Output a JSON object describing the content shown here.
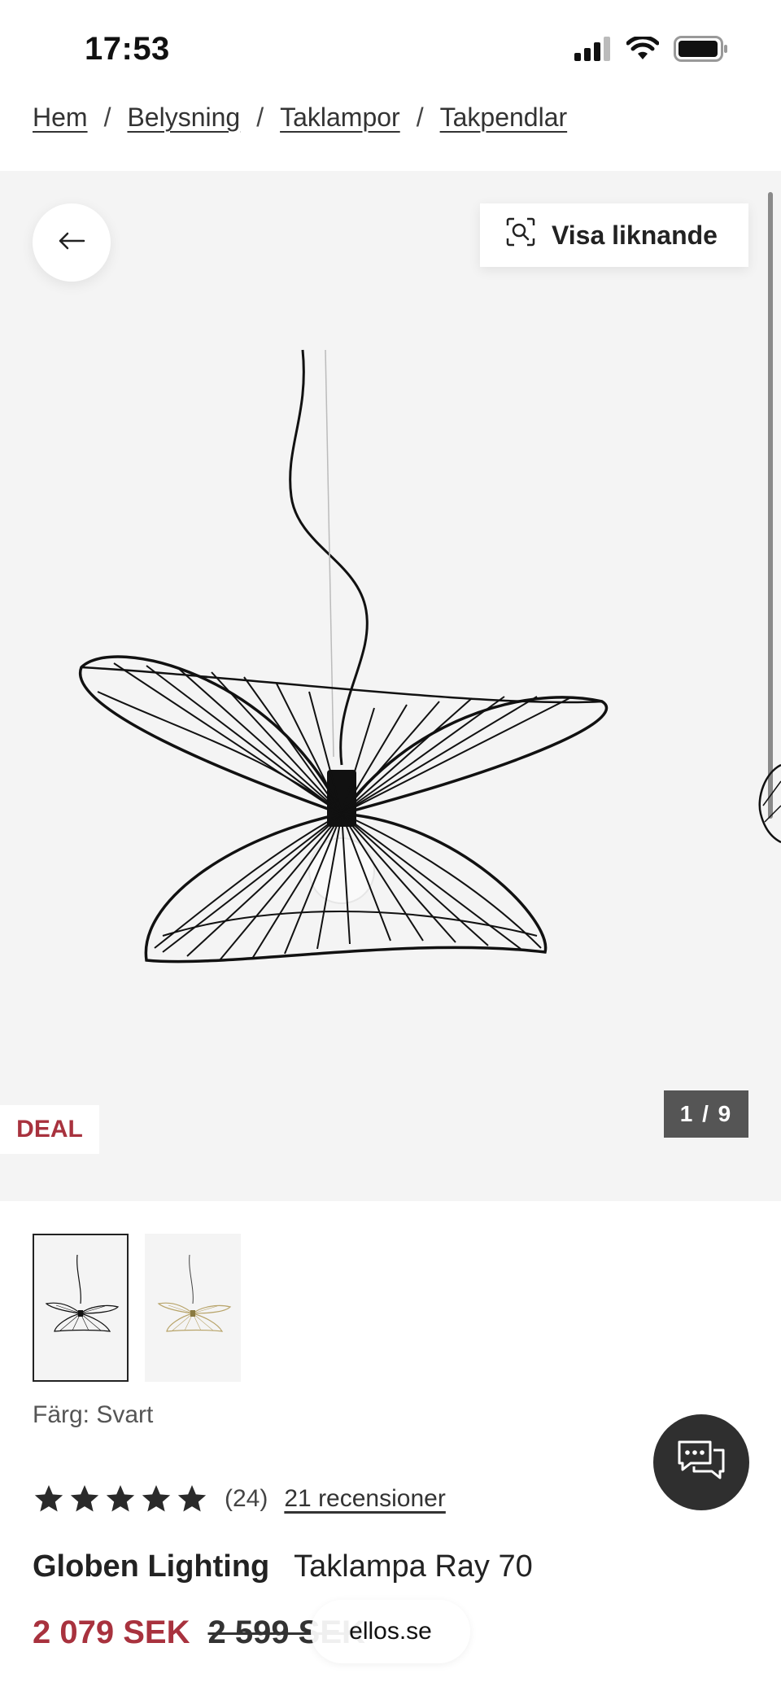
{
  "status_bar": {
    "time": "17:53"
  },
  "breadcrumb": [
    "Hem",
    "Belysning",
    "Taklampor",
    "Takpendlar"
  ],
  "gallery": {
    "similar_label": "Visa liknande",
    "deal_label": "DEAL",
    "counter": "1 / 9"
  },
  "product": {
    "color_line": "Färg: Svart",
    "rating": 5,
    "rating_count": "(24)",
    "reviews_link": "21 recensioner",
    "brand": "Globen Lighting",
    "name": "Taklampa Ray 70",
    "price_now": "2 079 SEK",
    "price_old": "2 599 SEK"
  },
  "browser": {
    "domain": "ellos.se"
  },
  "colors": {
    "accent_red": "#a8323e",
    "gallery_bg": "#f4f4f4",
    "counter_bg": "#555555",
    "chat_bg": "#2f2f2f"
  },
  "icons": [
    "signal-icon",
    "wifi-icon",
    "battery-icon",
    "arrow-left-icon",
    "visual-search-icon",
    "chat-icon",
    "star-icon"
  ]
}
